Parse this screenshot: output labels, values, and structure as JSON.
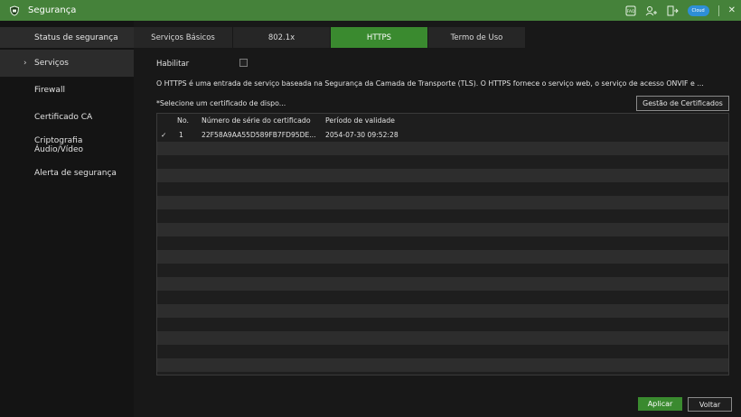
{
  "window": {
    "title": "Segurança"
  },
  "titlebar": {
    "faq_label": "FAQ",
    "cloud_label": "Cloud",
    "close_glyph": "✕"
  },
  "sidebar": {
    "status_label": "Status de segurança",
    "items": [
      {
        "label": "Serviços",
        "active": true
      },
      {
        "label": "Firewall"
      },
      {
        "label": "Certificado CA"
      },
      {
        "label": "Criptografia Áudio/Vídeo"
      },
      {
        "label": "Alerta de segurança"
      }
    ]
  },
  "tabs": [
    {
      "label": "Serviços Básicos"
    },
    {
      "label": "802.1x"
    },
    {
      "label": "HTTPS",
      "active": true
    },
    {
      "label": "Termo de Uso"
    }
  ],
  "form": {
    "enable_label": "Habilitar",
    "enable_checked": false,
    "description": "O HTTPS é uma entrada de serviço baseada na Segurança da Camada de Transporte (TLS). O HTTPS fornece o serviço web, o serviço de acesso ONVIF e ...",
    "select_label": "*Selecione um certificado de dispo...",
    "cert_button": "Gestão de Certificados"
  },
  "table": {
    "headers": {
      "no": "No.",
      "serial": "Número de série do certificado",
      "validity": "Período de validade"
    },
    "rows": [
      {
        "check": "✓",
        "no": "1",
        "serial": "22F58A9AA55D589FB7FD95DE...",
        "validity": "2054-07-30 09:52:28"
      }
    ]
  },
  "footer": {
    "apply": "Aplicar",
    "back": "Voltar"
  },
  "colors": {
    "accent": "#3a8a2f",
    "titlebar": "#45823a",
    "background": "#181818"
  }
}
